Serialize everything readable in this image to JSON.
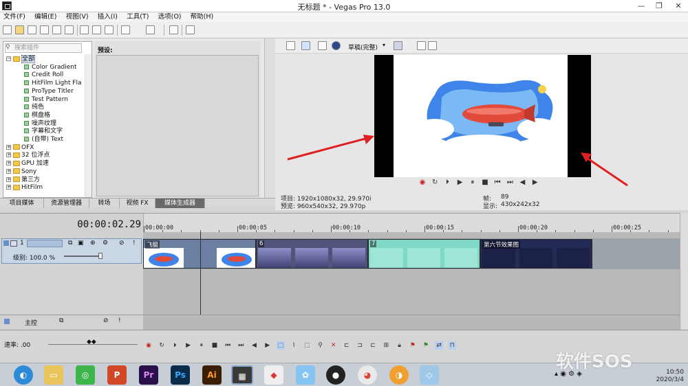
{
  "window": {
    "title": "无标题 * - Vegas Pro 13.0"
  },
  "menu": [
    "文件(F)",
    "编辑(E)",
    "视图(V)",
    "插入(I)",
    "工具(T)",
    "选项(O)",
    "帮助(H)"
  ],
  "plugin_search": {
    "placeholder": "搜索插件"
  },
  "tree": [
    {
      "label": "全部",
      "kind": "folder",
      "expanded": true,
      "selected": true
    },
    {
      "label": "Color Gradient",
      "kind": "plugin"
    },
    {
      "label": "Credit Roll",
      "kind": "plugin"
    },
    {
      "label": "HitFilm Light Fla",
      "kind": "plugin"
    },
    {
      "label": "ProType Titler",
      "kind": "plugin"
    },
    {
      "label": "Test Pattern",
      "kind": "plugin"
    },
    {
      "label": "纯色",
      "kind": "plugin"
    },
    {
      "label": "棋盘格",
      "kind": "plugin"
    },
    {
      "label": "噪声纹理",
      "kind": "plugin"
    },
    {
      "label": "字幕和文字",
      "kind": "plugin"
    },
    {
      "label": "(自带) Text",
      "kind": "plugin"
    },
    {
      "label": "OFX",
      "kind": "folder"
    },
    {
      "label": "32 位浮点",
      "kind": "folder"
    },
    {
      "label": "GPU 加速",
      "kind": "folder"
    },
    {
      "label": "Sony",
      "kind": "folder"
    },
    {
      "label": "第三方",
      "kind": "folder"
    },
    {
      "label": "HitFilm",
      "kind": "folder"
    }
  ],
  "preset_label": "预设:",
  "tabs": [
    "项目媒体",
    "资源管理器",
    "转场",
    "视频 FX",
    "媒体生成器"
  ],
  "active_tab": "媒体生成器",
  "preview": {
    "quality": "草稿(完整)",
    "project": "项目: 1920x1080x32, 29.970i",
    "preview": "预览: 960x540x32, 29.970p",
    "frame_label": "帧:",
    "frame_value": "89",
    "display_label": "显示:",
    "display_value": "430x242x32"
  },
  "timeline": {
    "timecode": "00:00:02.29",
    "ruler": [
      "00:00:00",
      "00:00:05",
      "00:00:10",
      "00:00:15",
      "00:00:20",
      "00:00:25"
    ],
    "track_number": "1",
    "level": "级别: 100.0 %",
    "master": "主控",
    "rate": "速率: .00",
    "clips": [
      {
        "name": "飞艇"
      },
      {
        "name": "6"
      },
      {
        "name": "7"
      },
      {
        "name": "第六节效果图"
      }
    ]
  },
  "taskbar": {
    "time": "10:50",
    "date": "2020/3/4"
  },
  "watermark": "软件SOS",
  "colors": {
    "clip_border": "#2a2a2a",
    "active_tab": "#6a6a6a",
    "arrow": "#e02020"
  }
}
